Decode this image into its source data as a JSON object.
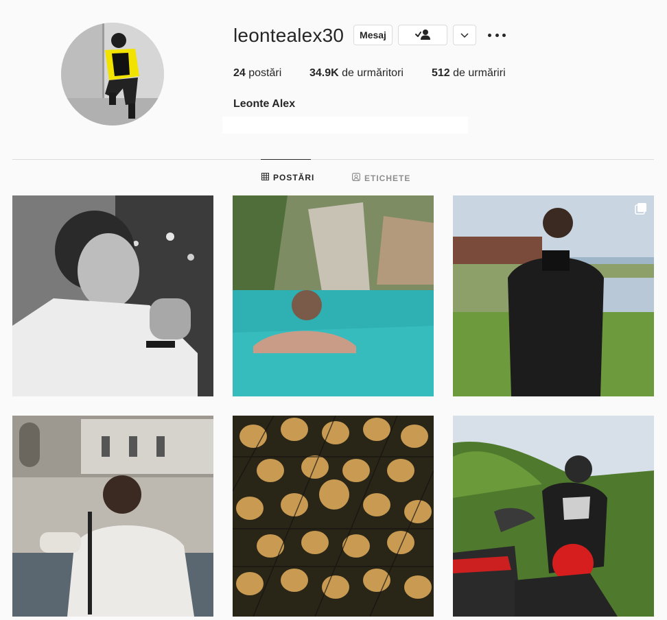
{
  "profile": {
    "username": "leontealex30",
    "full_name": "Leonte Alex",
    "stats": {
      "posts_count": "24",
      "posts_label": "postări",
      "followers_count": "34.9K",
      "followers_label": "de urmăritori",
      "following_count": "512",
      "following_label": "de urmăriri"
    }
  },
  "actions": {
    "message_label": "Mesaj",
    "following_icon": "person-check-icon",
    "dropdown_icon": "chevron-down-icon",
    "more_icon": "more-horizontal-icon"
  },
  "tabs": [
    {
      "label": "POSTĂRI",
      "icon": "grid-icon",
      "active": true
    },
    {
      "label": "ETICHETE",
      "icon": "tagged-person-icon",
      "active": false
    }
  ],
  "posts": [
    {
      "description": "black and white portrait smoking"
    },
    {
      "description": "swimming in turquoise pool under waterfall"
    },
    {
      "description": "black suit outdoors by lake",
      "multiple_icon": "carousel-icon"
    },
    {
      "description": "seated in square with hookah"
    },
    {
      "description": "kaleidoscope mirror selfie"
    },
    {
      "description": "motorcycle and red helmet on hill"
    }
  ]
}
